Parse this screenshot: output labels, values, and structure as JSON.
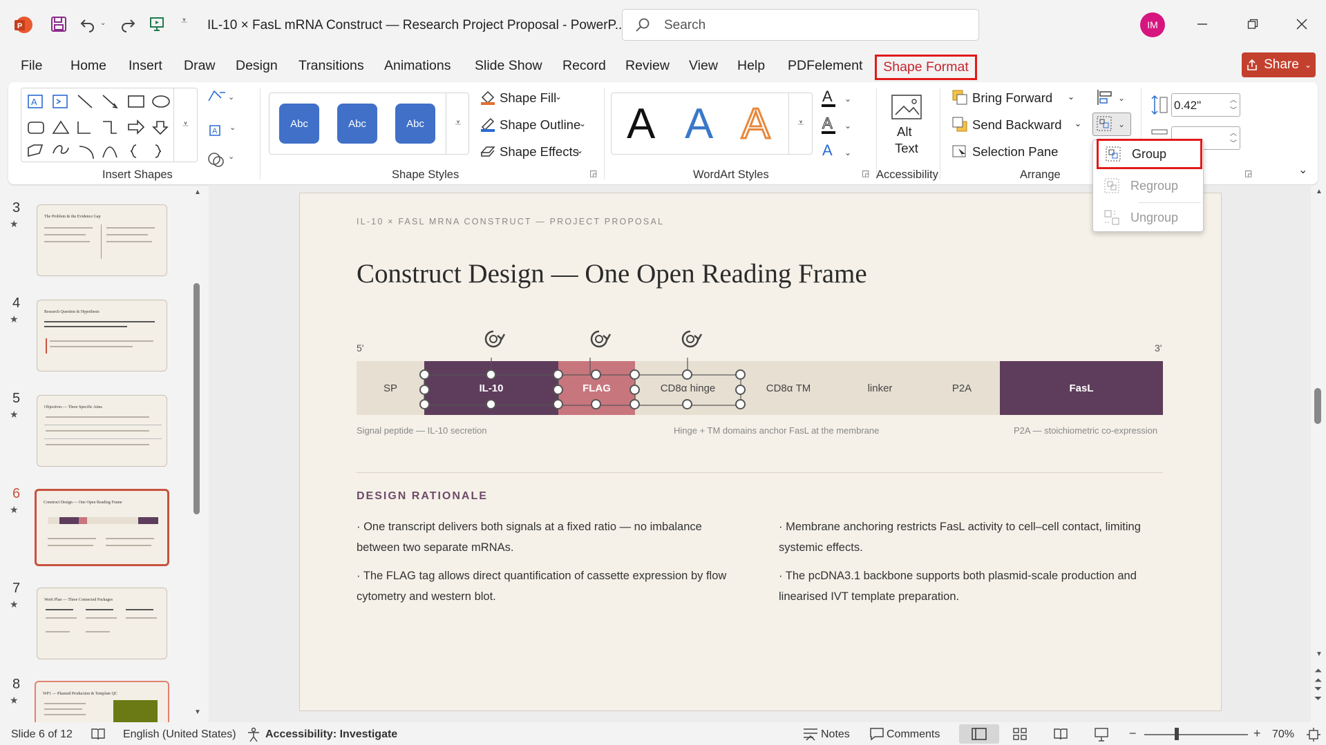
{
  "titlebar": {
    "doc_title": "IL-10 × FasL mRNA Construct — Research Project Proposal  -  PowerP...",
    "search_placeholder": "Search",
    "user_initials": "IM"
  },
  "menu": {
    "tabs": [
      "File",
      "Home",
      "Insert",
      "Draw",
      "Design",
      "Transitions",
      "Animations",
      "Slide Show",
      "Record",
      "Review",
      "View",
      "Help",
      "PDFelement",
      "Shape Format"
    ],
    "active_tab": "Shape Format",
    "share_label": "Share"
  },
  "ribbon": {
    "groups": {
      "insert_shapes": "Insert Shapes",
      "shape_styles": "Shape Styles",
      "wordart_styles": "WordArt Styles",
      "accessibility": "Accessibility",
      "arrange": "Arrange"
    },
    "style_swatch_label": "Abc",
    "shape_fill": "Shape Fill",
    "shape_outline": "Shape Outline",
    "shape_effects": "Shape Effects",
    "wordart_letter": "A",
    "alt_text_line1": "Alt",
    "alt_text_line2": "Text",
    "bring_forward": "Bring Forward",
    "send_backward": "Send Backward",
    "selection_pane": "Selection Pane",
    "height_value": "0.42\"",
    "colors": {
      "accent": "#c4262e",
      "style_blue": "#4070c8",
      "wordart_blue": "#3a78c9",
      "wordart_orange": "#e8873a"
    }
  },
  "group_menu": {
    "items": [
      "Group",
      "Regroup",
      "Ungroup"
    ],
    "highlighted": "Group"
  },
  "thumbnails": [
    {
      "number": "3",
      "title": "The Problem & the Evidence Gap"
    },
    {
      "number": "4",
      "title": "Research Question & Hypothesis"
    },
    {
      "number": "5",
      "title": "Objectives — Three Specific Aims"
    },
    {
      "number": "6",
      "title": "Construct Design — One Open Reading Frame",
      "selected": true
    },
    {
      "number": "7",
      "title": "Work Plan — Three Connected Packages"
    },
    {
      "number": "8",
      "title": "WP1 — Plasmid Production & Template QC"
    }
  ],
  "slide": {
    "eyebrow": "IL-10 × FASL MRNA CONSTRUCT — PROJECT PROPOSAL",
    "title": "Construct Design — One Open Reading Frame",
    "five_prime": "5'",
    "three_prime": "3'",
    "segments": [
      "SP",
      "IL-10",
      "FLAG",
      "CD8α hinge",
      "CD8α TM",
      "linker",
      "P2A",
      "FasL"
    ],
    "captions": [
      "Signal peptide — IL-10 secretion",
      "Hinge + TM domains anchor FasL at the membrane",
      "P2A — stoichiometric co-expression"
    ],
    "rationale_heading": "DESIGN RATIONALE",
    "bullets": [
      "· One transcript delivers both signals at a fixed ratio — no imbalance between two separate mRNAs.",
      "· The FLAG tag allows direct quantification of cassette expression by flow cytometry and western blot.",
      "· Membrane anchoring restricts FasL activity to cell–cell contact, limiting systemic effects.",
      "· The pcDNA3.1 backbone supports both plasmid-scale production and linearised IVT template preparation."
    ],
    "colors": {
      "segment_dark": "#5e3d5c",
      "segment_flag": "#c8767e",
      "segment_light": "#e6dfd2",
      "heading": "#6e4a6a"
    }
  },
  "statusbar": {
    "slide_info": "Slide 6 of 12",
    "language": "English (United States)",
    "accessibility": "Accessibility: Investigate",
    "notes": "Notes",
    "comments": "Comments",
    "zoom": "70%"
  }
}
